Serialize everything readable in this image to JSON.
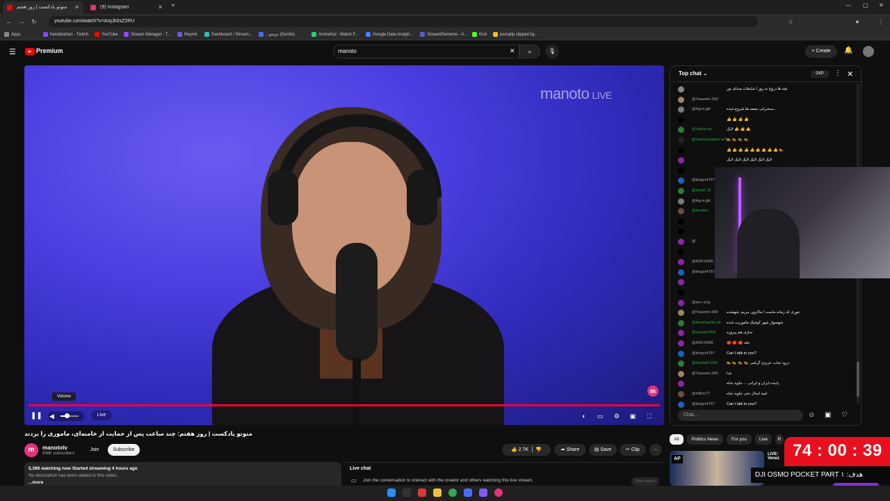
{
  "browser": {
    "tabs": [
      {
        "label": "منوتو پادکست | روز هفتم",
        "active": true,
        "color": "#ff0000"
      },
      {
        "label": "(9) Instagram",
        "active": false,
        "color": "#e1306c"
      }
    ],
    "url": "youtube.com/watch?v=ArqJk0sZ2RU",
    "bookmarks": [
      {
        "label": "Apps",
        "color": "#888888"
      },
      {
        "label": "hamidstefan - Twitch",
        "color": "#9146ff"
      },
      {
        "label": "YouTube",
        "color": "#ff0000"
      },
      {
        "label": "Stream Manager - T...",
        "color": "#9146ff"
      },
      {
        "label": "Reymit",
        "color": "#6c5ce7"
      },
      {
        "label": "Dashboard / Stream...",
        "color": "#2ec4b6"
      },
      {
        "label": "...دونیتو (Donito)",
        "color": "#4a6cf7"
      },
      {
        "label": "AnimeKai - Watch F...",
        "color": "#2ecc71"
      },
      {
        "label": "Google Data Analyti...",
        "color": "#4285f4"
      },
      {
        "label": "StreamElements - A...",
        "color": "#5b5bd6"
      },
      {
        "label": "Kick",
        "color": "#53fc18"
      },
      {
        "label": "parsalip clipped by...",
        "color": "#f1c40f"
      }
    ]
  },
  "youtube": {
    "brand": "Premium",
    "search_value": "manoto",
    "create_label": "Create",
    "video": {
      "watermark": "manoto",
      "watermark_live": "LIVE",
      "volume_tooltip": "Volume",
      "live_label": "Live",
      "volume_level": 0.35,
      "title": "منوتو پادکست | روز هفتم: چند ساعت پس از حمایت از خامنه‌ای، ماموری را بردند"
    },
    "channel": {
      "name": "manototv",
      "subscribers": "936K subscribers",
      "join_label": "Join",
      "subscribe_label": "Subscribe"
    },
    "actions": {
      "likes": "2.7K",
      "share": "Share",
      "save": "Save",
      "clip": "Clip"
    },
    "description": {
      "stats": "5,389 watching now  Started streaming 4 hours ago",
      "text": "No description has been added to this video.",
      "more": "...more"
    },
    "livechat": {
      "label": "Live chat",
      "join_text": "Join the conversation to interact with the creator and others watching this live stream.",
      "open_panel": "Open panel"
    },
    "chat": {
      "header": "Top chat",
      "points": "0XP",
      "input_placeholder": "Chat...",
      "messages": [
        {
          "user": "",
          "text": "بچه ها دروغ نه زور / شایعات صدای نور",
          "color": "#888888",
          "green": false
        },
        {
          "user": "@Yasamin-369",
          "text": "",
          "color": "#a0836c",
          "green": false
        },
        {
          "user": "@Hg.m.jjkl",
          "text": "سخنرانی جمعه ها شروع شده...",
          "color": "#7a7a7a",
          "green": false
        },
        {
          "user": "",
          "text": "👍 👍 👍 👍",
          "color": "#000000",
          "green": false
        },
        {
          "user": "@Jakob-ulu",
          "text": "لایک 👍 👍 👍",
          "color": "#2e7d32",
          "green": true
        },
        {
          "user": "@SabrinaSaberi-w7y",
          "text": "🐅 🐅 🐅 🐅",
          "color": "#222222",
          "green": true
        },
        {
          "user": "",
          "text": "👍 👍 👍 👍 👍 👍 👍 👍 👍 🐅",
          "color": "#000000",
          "green": false
        },
        {
          "user": "",
          "text": "لایک لایک لایک لایک لایک لایک",
          "color": "#8e24aa",
          "green": false
        },
        {
          "user": "",
          "text": "👍 👍 👍 👍 👍 👍 👍 👍 👍 👍",
          "color": "#000000",
          "green": false
        },
        {
          "user": "@kingor4797",
          "text": "",
          "color": "#1565c0",
          "green": false
        },
        {
          "user": "@kaveh_B",
          "text": "",
          "color": "#2e7d32",
          "green": true
        },
        {
          "user": "@Hg.m.jjkl",
          "text": "",
          "color": "#7a7a7a",
          "green": false
        },
        {
          "user": "@kresten",
          "text": "",
          "color": "#6d4c41",
          "green": true
        },
        {
          "user": "",
          "text": "",
          "color": "#000000",
          "green": false
        },
        {
          "user": "",
          "text": "",
          "color": "#000000",
          "green": false
        },
        {
          "user": "@",
          "text": "",
          "color": "#8e24aa",
          "green": false
        },
        {
          "user": "",
          "text": "",
          "color": "#000000",
          "green": false
        },
        {
          "user": "@ASF.hl386",
          "text": "",
          "color": "#8e24aa",
          "green": false
        },
        {
          "user": "@kingor4797",
          "text": "",
          "color": "#1565c0",
          "green": false
        },
        {
          "user": "",
          "text": "",
          "color": "#8e24aa",
          "green": false
        },
        {
          "user": "",
          "text": "",
          "color": "#000000",
          "green": false
        },
        {
          "user": "@ah.r-w1p",
          "text": "",
          "color": "#8e24aa",
          "green": false
        },
        {
          "user": "@Yasamin-369",
          "text": "جوری که زمانه ماست / ماکرون ببریم، شهشده",
          "color": "#a0836c",
          "green": false
        },
        {
          "user": "@AmirDashti-z4r",
          "text": "شهسوار شهر کوچیک ماموریت شده",
          "color": "#2e7d32",
          "green": true
        },
        {
          "user": "@mavan3405",
          "text": "سازی هم پیروزه",
          "color": "#8e24aa",
          "green": true
        },
        {
          "user": "@ASF.hl386",
          "text": "🍎 🍎 🍎 حله",
          "color": "#8e24aa",
          "green": false
        },
        {
          "user": "@kingor4797",
          "text": "Can I talk to you?",
          "color": "#1565c0",
          "green": false
        },
        {
          "user": "@FaribaF1234",
          "text": "🐅 🐅 🐅 🐅 درود جناب عزیزی گرامی",
          "color": "#2e7d32",
          "green": true
        },
        {
          "user": "@Yasamin-369",
          "text": "عدا",
          "color": "#a0836c",
          "green": false
        },
        {
          "user": "",
          "text": "پاینده ایران و ایرانی ... جاوید شاه",
          "color": "#8e24aa",
          "green": false
        },
        {
          "user": "@mBoo77",
          "text": "امید ایحال ختی جاوید شاه",
          "color": "#6d4c41",
          "green": false
        },
        {
          "user": "@kingor4797",
          "text": "Can I talk to you?",
          "color": "#1565c0",
          "green": false
        }
      ]
    },
    "chips": [
      "All",
      "Politics News",
      "For you",
      "Live",
      "R"
    ],
    "recommended": {
      "badge": "AP",
      "title": "LIVE: Venez"
    }
  },
  "stream_overlay": {
    "timer": "74 : 00 : 39",
    "goal": "DJI OSMO POCKET PART ۱ :هدف"
  },
  "colors": {
    "youtube_red": "#ff0000",
    "progress": "#ff0033",
    "accent_pink": "#e0357d",
    "timer_bg": "#e8101e"
  }
}
